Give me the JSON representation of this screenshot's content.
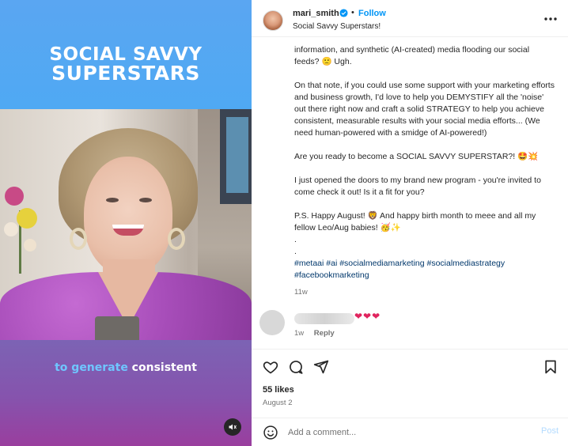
{
  "media": {
    "brand_line1": "SOCIAL SAVVY",
    "brand_line2": "SUPERSTARS",
    "caption_highlight": "to generate",
    "caption_rest": " consistent"
  },
  "header": {
    "username": "mari_smith",
    "separator": "•",
    "follow_label": "Follow",
    "audio": "Social Savvy Superstars!"
  },
  "caption": {
    "paragraphs": [
      "information, and synthetic (AI-created) media flooding our social feeds? 🙁 Ugh.",
      "On that note, if you could use some support with your marketing efforts and business growth, I'd love to help you DEMYSTIFY all the 'noise' out there right now and craft a solid STRATEGY to help you achieve consistent, measurable results with your social media efforts... (We need human-powered with a smidge of AI-powered!)",
      "Are you ready to become a SOCIAL SAVVY SUPERSTAR?! 🤩💥",
      "I just opened the doors to my brand new program - you're invited to come check it out! Is it a fit for you?",
      "P.S. Happy August! 🦁 And happy birth month to meee and all my fellow Leo/Aug babies! 🥳✨"
    ],
    "dot1": ".",
    "dot2": ".",
    "hashtags_line1": "#metaai #ai #socialmediamarketing #socialmediastrategy",
    "hashtags_line2": "#facebookmarketing",
    "time_ago": "11w"
  },
  "reply": {
    "text": "❤❤❤",
    "time": "1w",
    "reply_label": "Reply"
  },
  "actions": {
    "likes": "55 likes",
    "date": "August 2"
  },
  "add_comment": {
    "placeholder": "Add a comment...",
    "post_label": "Post"
  },
  "colors": {
    "link_blue": "#0095f6",
    "hashtag": "#00376b",
    "post_disabled": "#b3dbff",
    "heart_red": "#e0245e"
  },
  "icons": [
    "verified-badge-icon",
    "more-options-icon",
    "heart-icon",
    "comment-icon",
    "share-icon",
    "bookmark-icon",
    "emoji-icon",
    "mute-icon"
  ]
}
